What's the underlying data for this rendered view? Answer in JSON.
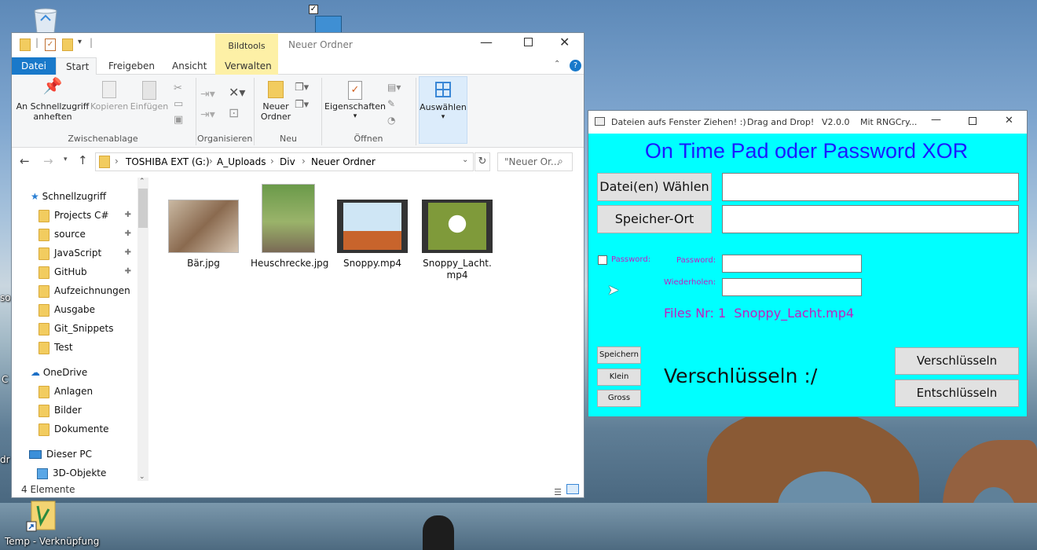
{
  "desktop": {
    "shortcut_label": "Temp - Verknüpfung",
    "left_edge_labels": [
      "so",
      "C",
      "dr"
    ]
  },
  "explorer": {
    "contextual_tab": "Bildtools",
    "window_title": "Neuer Ordner",
    "tabs": [
      "Datei",
      "Start",
      "Freigeben",
      "Ansicht",
      "Verwalten"
    ],
    "ribbon": {
      "pin": "An Schnellzugriff anheften",
      "copy": "Kopieren",
      "paste": "Einfügen",
      "new_folder": "Neuer Ordner",
      "properties": "Eigenschaften",
      "select": "Auswählen",
      "groups": {
        "clipboard": "Zwischenablage",
        "organize": "Organisieren",
        "new": "Neu",
        "open": "Öffnen"
      }
    },
    "breadcrumb": [
      "TOSHIBA EXT (G:)",
      "A_Uploads",
      "Div",
      "Neuer Ordner"
    ],
    "search_placeholder": "\"Neuer Or...",
    "nav": {
      "quick_access": "Schnellzugriff",
      "quick_items": [
        "Projects C#",
        "source",
        "JavaScript",
        "GitHub",
        "Aufzeichnungen",
        "Ausgabe",
        "Git_Snippets",
        "Test"
      ],
      "onedrive": "OneDrive",
      "onedrive_items": [
        "Anlagen",
        "Bilder",
        "Dokumente"
      ],
      "this_pc": "Dieser PC",
      "pc_items": [
        "3D-Objekte"
      ]
    },
    "files": [
      "Bär.jpg",
      "Heuschrecke.jpg",
      "Snoppy.mp4",
      "Snoppy_Lacht.mp4"
    ],
    "status": "4 Elemente"
  },
  "app": {
    "title": "Dateien aufs Fenster Ziehen! :)",
    "title_extra_1": "Drag and Drop!",
    "title_extra_2": "V2.0.0",
    "title_extra_3": "Mit RNGCry...",
    "header": "On Time Pad oder Password XOR",
    "choose_files": "Datei(en) Wählen",
    "save_location": "Speicher-Ort",
    "password_checkbox": "Password:",
    "password_label": "Password:",
    "repeat_label": "Wiederholen:",
    "files_info": "Files Nr: 1  Snoppy_Lacht.mp4",
    "save_btn": "Speichern",
    "small_btn": "Klein",
    "large_btn": "Gross",
    "status_text": "Verschlüsseln :/",
    "encrypt_btn": "Verschlüsseln",
    "decrypt_btn": "Entschlüsseln",
    "accent": "#00ffff",
    "header_color": "#1a1aff",
    "label_color": "#c020c0"
  }
}
